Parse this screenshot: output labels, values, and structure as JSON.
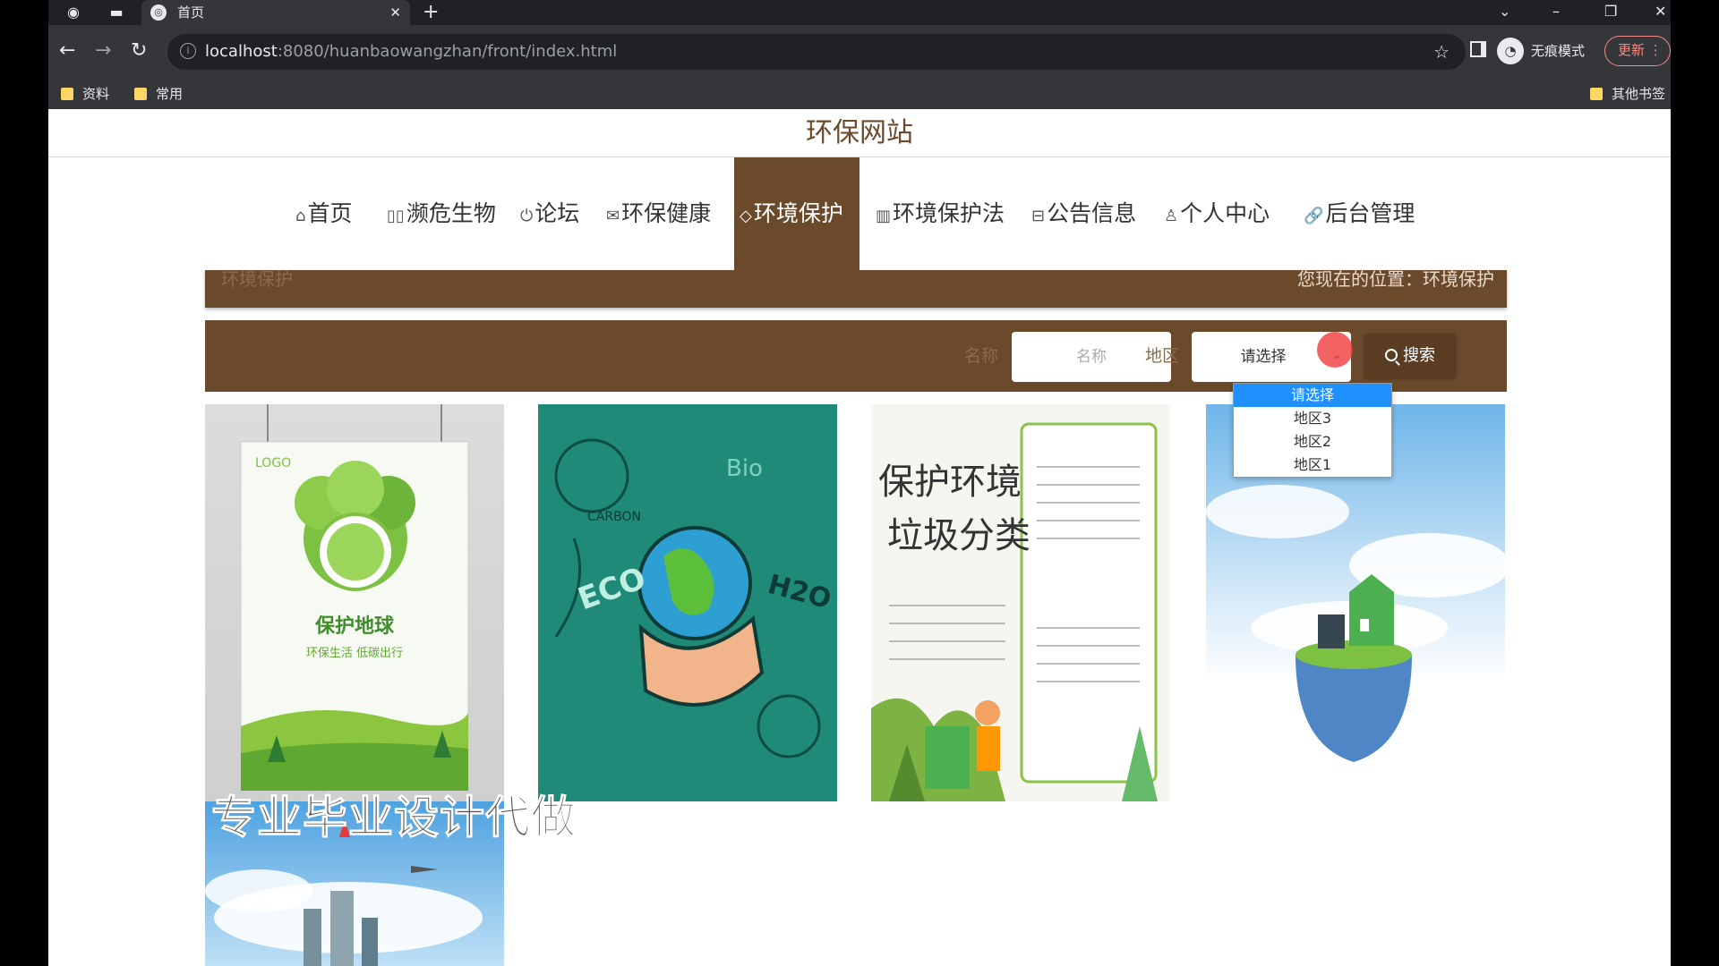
{
  "browser": {
    "tab_title": "首页",
    "url_host": "localhost",
    "url_path": ":8080/huanbaowangzhan/front/index.html",
    "incognito_label": "无痕模式",
    "update_label": "更新",
    "bookmarks": [
      "资料",
      "常用"
    ],
    "other_bookmarks": "其他书签"
  },
  "site": {
    "title": "环保网站",
    "nav": [
      {
        "label": "首页",
        "icon": "⌂"
      },
      {
        "label": "濒危生物",
        "icon": "▯▯"
      },
      {
        "label": "论坛",
        "icon": "⏻"
      },
      {
        "label": "环保健康",
        "icon": "✉"
      },
      {
        "label": "环境保护",
        "icon": "◇"
      },
      {
        "label": "环境保护法",
        "icon": "▥"
      },
      {
        "label": "公告信息",
        "icon": "⊟"
      },
      {
        "label": "个人中心",
        "icon": "♙"
      },
      {
        "label": "后台管理",
        "icon": "🔗"
      }
    ],
    "crumb_left": "环境保护",
    "crumb_right": "您现在的位置：环境保护",
    "search": {
      "name_label": "名称",
      "name_placeholder": "名称",
      "region_label": "地区",
      "region_selected": "请选择",
      "region_options": [
        "请选择",
        "地区3",
        "地区2",
        "地区1"
      ],
      "button": "搜索"
    },
    "cards": {
      "c1": {
        "line1": "保护地球",
        "line2": "环保生活 低碳出行",
        "logo": "LOGO"
      },
      "c2": {
        "w1": "ECO",
        "w2": "H2O",
        "w3": "Bio",
        "w4": "CARBON"
      },
      "c3": {
        "line1": "保护环境",
        "line2": "垃圾分类"
      }
    },
    "watermark": "专业毕业设计代做"
  }
}
